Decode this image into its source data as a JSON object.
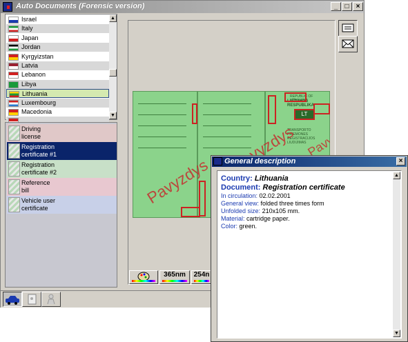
{
  "window": {
    "title": "Auto Documents (Forensic version)",
    "min": "_",
    "max": "□",
    "close": "×"
  },
  "countries": [
    {
      "name": "Israel",
      "colors": [
        "#fff",
        "#1a3ab0"
      ]
    },
    {
      "name": "Italy",
      "colors": [
        "#1a9a3a",
        "#fff",
        "#d02020"
      ]
    },
    {
      "name": "Japan",
      "colors": [
        "#fff",
        "#d02020"
      ]
    },
    {
      "name": "Jordan",
      "colors": [
        "#000",
        "#fff",
        "#1a9a3a"
      ]
    },
    {
      "name": "Kyrgyizstan",
      "colors": [
        "#d02020",
        "#ffd000"
      ]
    },
    {
      "name": "Latvia",
      "colors": [
        "#9a2030",
        "#fff"
      ]
    },
    {
      "name": "Lebanon",
      "colors": [
        "#d02020",
        "#fff"
      ]
    },
    {
      "name": "Libya",
      "colors": [
        "#1a9a3a",
        "#1a9a3a"
      ]
    },
    {
      "name": "Lithuania",
      "colors": [
        "#ffd000",
        "#1a9a3a",
        "#d02020"
      ]
    },
    {
      "name": "Luxembourg",
      "colors": [
        "#d02020",
        "#fff",
        "#2a7ad0"
      ]
    },
    {
      "name": "Macedonia",
      "colors": [
        "#d02020",
        "#ffd000"
      ]
    },
    {
      "name": "...",
      "colors": [
        "#d02020",
        "#fff"
      ]
    }
  ],
  "selected_country": "Lithuania",
  "documents": [
    {
      "label": "Driving\nlicense",
      "bg": "#e0c8c8"
    },
    {
      "label": "Registration\ncertificate #1",
      "bg": "#0a246a",
      "selected": true
    },
    {
      "label": "Registration\ncertificate #2",
      "bg": "#c8e0c8"
    },
    {
      "label": "Reference\nbill",
      "bg": "#e8c8d0"
    },
    {
      "label": "Vehicle user\ncertificate",
      "bg": "#c8d0e8"
    }
  ],
  "uv_tabs": [
    "",
    "365nm",
    "254n"
  ],
  "document_image": {
    "stamp": "Pavyzdys",
    "header_lines": [
      "REPUBLIC OF LITHUANIA",
      "LIETUVOS RESPUBLIKA"
    ],
    "plate": "LT",
    "footer": "TRANSPORTO PRIEMONES REGISTRACIJOS LIUDIJIMAS"
  },
  "popup": {
    "title": "General description",
    "country_label": "Country:",
    "country_value": "Lithuania",
    "document_label": "Document:",
    "document_value": "Registration certificate",
    "rows": [
      {
        "label": "In circulation:",
        "value": "02.02.2001"
      },
      {
        "label": "General view:",
        "value": "folded three times form"
      },
      {
        "label": "Unfolded size:",
        "value": "210x105 mm."
      },
      {
        "label": "Material:",
        "value": "cartridge paper."
      },
      {
        "label": "Color:",
        "value": "green."
      }
    ]
  }
}
